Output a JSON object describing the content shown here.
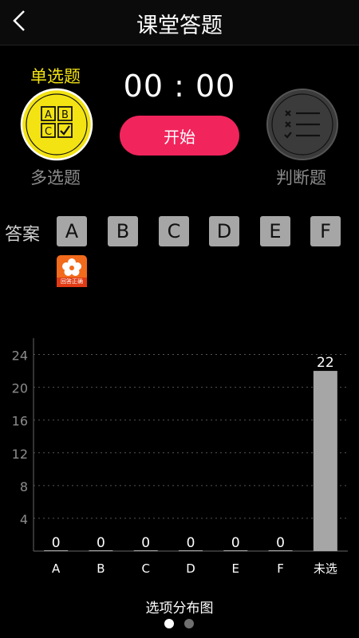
{
  "header": {
    "title": "课堂答题"
  },
  "question_types": {
    "single_label": "单选题",
    "multi_label": "多选题",
    "judge_label": "判断题",
    "single_icon_letters": [
      "A",
      "B",
      "C"
    ]
  },
  "timer": {
    "display": "00 : 00"
  },
  "start_button": {
    "label": "开始"
  },
  "answer": {
    "label": "答案",
    "options": [
      "A",
      "B",
      "C",
      "D",
      "E",
      "F"
    ],
    "badge_text": "回答正确"
  },
  "colors": {
    "accent_yellow": "#f3e313",
    "start_pink": "#f2245c",
    "bar_gray": "#a6a6a6"
  },
  "chart_data": {
    "type": "bar",
    "title": "选项分布图",
    "categories": [
      "A",
      "B",
      "C",
      "D",
      "E",
      "F",
      "未选"
    ],
    "values": [
      0,
      0,
      0,
      0,
      0,
      0,
      22
    ],
    "ylim": [
      0,
      26
    ],
    "yticks": [
      4,
      8,
      12,
      16,
      20,
      24
    ],
    "grid": true
  },
  "pager": {
    "count": 2,
    "active": 0
  }
}
